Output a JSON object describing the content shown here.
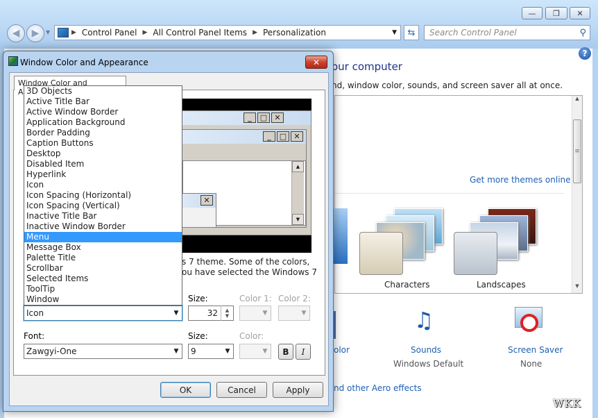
{
  "explorer": {
    "breadcrumb": [
      "Control Panel",
      "All Control Panel Items",
      "Personalization"
    ],
    "search_placeholder": "Search Control Panel",
    "heading": "our computer",
    "subheading": "nd, window color, sounds, and screen saver all at once.",
    "get_more_themes": "Get more themes online",
    "themes": [
      {
        "label": "Characters"
      },
      {
        "label": "Landscapes"
      }
    ],
    "bottom_items": {
      "color_label": "olor",
      "sounds_label": "Sounds",
      "sounds_value": "Windows Default",
      "screensaver_label": "Screen Saver",
      "screensaver_value": "None",
      "aero_link": "nd other Aero effects"
    },
    "watermark": "WKK"
  },
  "dialog": {
    "title": "Window Color and Appearance",
    "tab": "Window Color and Appearance",
    "close_glyph": "✕",
    "description_line1": "s 7 theme.  Some of the colors,",
    "description_line2": "ou have selected the Windows 7",
    "item_list": [
      "3D Objects",
      "Active Title Bar",
      "Active Window Border",
      "Application Background",
      "Border Padding",
      "Caption Buttons",
      "Desktop",
      "Disabled Item",
      "Hyperlink",
      "Icon",
      "Icon Spacing (Horizontal)",
      "Icon Spacing (Vertical)",
      "Inactive Title Bar",
      "Inactive Window Border",
      "Menu",
      "Message Box",
      "Palette Title",
      "Scrollbar",
      "Selected Items",
      "ToolTip",
      "Window"
    ],
    "highlighted_item": "Menu",
    "item_selected": "Icon",
    "size_label": "Size:",
    "size_value": "32",
    "color1_label": "Color 1:",
    "color2_label": "Color 2:",
    "font_label": "Font:",
    "font_value": "Zawgyi-One",
    "font_size_label": "Size:",
    "font_size_value": "9",
    "font_color_label": "Color:",
    "bold_label": "B",
    "italic_label": "I",
    "ok_label": "OK",
    "cancel_label": "Cancel",
    "apply_label": "Apply"
  },
  "colors": {
    "selection": "#3399ff",
    "link": "#1e5fb4",
    "close_red": "#c9432f"
  }
}
